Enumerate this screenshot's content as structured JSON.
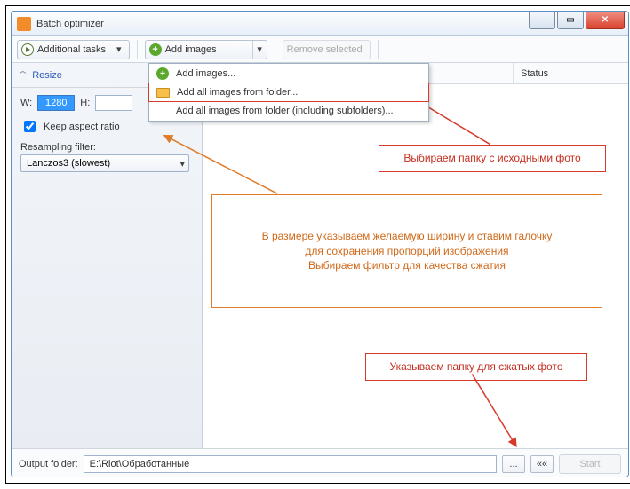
{
  "window": {
    "title": "Batch optimizer"
  },
  "toolbar": {
    "additional": "Additional tasks",
    "add": "Add images",
    "remove": "Remove selected"
  },
  "menu": {
    "item1": "Add images...",
    "item2": "Add all images from folder...",
    "item3": "Add all images from folder (including subfolders)..."
  },
  "side": {
    "head": "Resize",
    "w": "W:",
    "w_val": "1280",
    "h": "H:",
    "h_val": "",
    "keep": "Keep aspect ratio",
    "filter_lbl": "Resampling filter:",
    "filter_val": "Lanczos3 (slowest)"
  },
  "cols": {
    "status": "Status"
  },
  "bottom": {
    "label": "Output folder:",
    "path": "E:\\Riot\\Обработанные",
    "browse": "...",
    "back": "««",
    "start": "Start"
  },
  "callouts": {
    "c1": "Выбираем папку с исходными фото",
    "c2": "В размере указываем желаемую ширину и ставим галочку\nдля сохранения пропорций изображения\nВыбираем фильтр для качества сжатия",
    "c3": "Указываем папку для сжатых фото"
  }
}
